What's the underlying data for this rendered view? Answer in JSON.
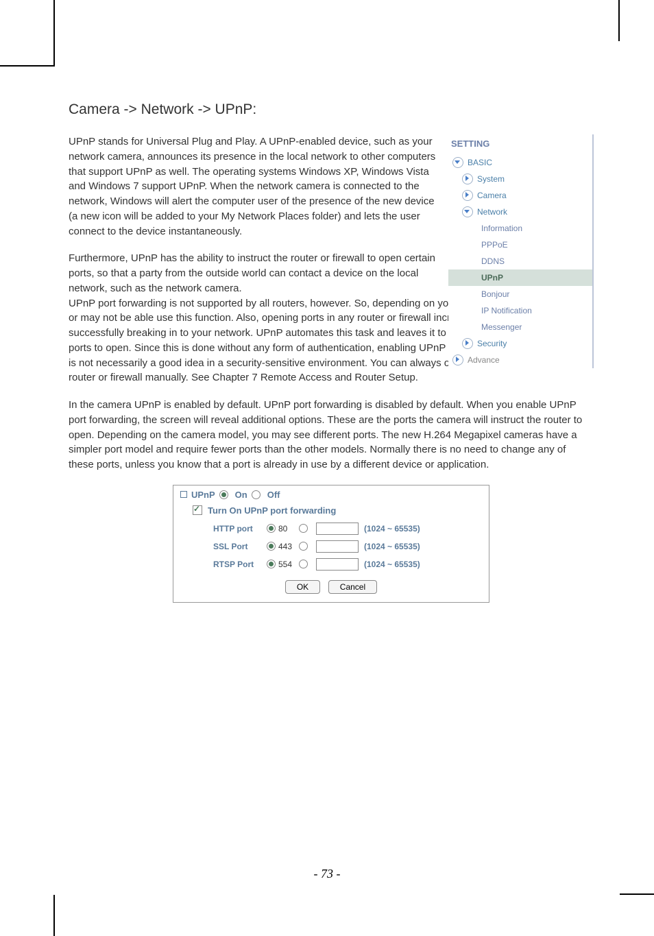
{
  "heading": "Camera -> Network -> UPnP:",
  "para1": "UPnP stands for Universal Plug and Play. A UPnP-enabled device, such as your network camera, announces its presence in the local network to other computers that support UPnP as well. The operating systems Windows XP, Windows Vista and Windows 7 support UPnP. When the network camera is connected to the network, Windows will alert the computer user of the presence of the new device (a new icon will be added to your My Network Places folder) and lets the user connect to the device instantaneously.",
  "para2": "Furthermore, UPnP has the ability to instruct the router or firewall to open certain ports, so that a party from the outside world can contact a device on the local network, such as the network camera.",
  "para3": "UPnP port forwarding is not supported by all routers, however. So, depending on your router or firewall, you may or may not be able use this function. Also, opening ports in any router or firewall increases the risk of an intruder successfully breaking in to your network. UPnP automates this task and leaves it to the devices to negotiate which ports to open. Since this is done without any form of authentication, enabling UPnP port forwarding in your router is not necessarily a good idea in a security-sensitive environment. You can always open individual ports in your router or firewall manually. See Chapter 7 Remote Access and Router Setup.",
  "para4": "In the camera UPnP is enabled by default. UPnP port forwarding is disabled by default. When you enable UPnP port forwarding, the screen will reveal additional options. These are the ports the camera will instruct the router to open. Depending on the camera model, you may see different ports. The new H.264 Megapixel cameras have a simpler port model and require fewer ports than the other models. Normally there is no need to change any of these ports, unless you know that a port is already in use by a different device or application.",
  "sidebar": {
    "setting": "SETTING",
    "basic": "BASIC",
    "system": "System",
    "camera": "Camera",
    "network": "Network",
    "information": "Information",
    "pppoe": "PPPoE",
    "ddns": "DDNS",
    "upnp": "UPnP",
    "bonjour": "Bonjour",
    "ipnotification": "IP Notification",
    "messenger": "Messenger",
    "security": "Security",
    "advance": "Advance"
  },
  "panel": {
    "title_upnp": "UPnP",
    "title_on": "On",
    "title_off": "Off",
    "forward": "Turn On UPnP port forwarding",
    "http_label": "HTTP port",
    "ssl_label": "SSL Port",
    "rtsp_label": "RTSP Port",
    "http_val": "80",
    "ssl_val": "443",
    "rtsp_val": "554",
    "range": "(1024 ~ 65535)",
    "ok": "OK",
    "cancel": "Cancel"
  },
  "page_number": "- 73 -"
}
